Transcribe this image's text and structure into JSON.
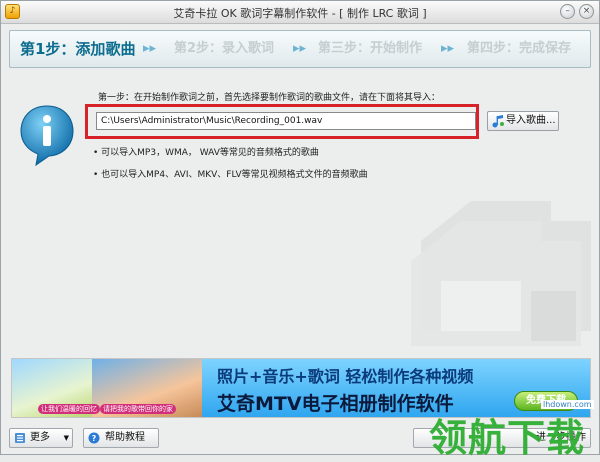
{
  "window": {
    "title": "艾奇卡拉 OK 歌词字幕制作软件 - [ 制作 LRC 歌词 ]",
    "app_icon_glyph": "♪"
  },
  "steps": [
    {
      "label": "第1步：添加歌曲",
      "active": true
    },
    {
      "label": "第2步：录入歌词",
      "active": false
    },
    {
      "label": "第三步：开始制作",
      "active": false
    },
    {
      "label": "第四步：完成保存",
      "active": false
    }
  ],
  "main": {
    "description": "第一步：在开始制作歌词之前，首先选择要制作歌词的歌曲文件，请在下面将其导入：",
    "file_path": "C:\\Users\\Administrator\\Music\\Recording_001.wav",
    "import_button": "导入歌曲...",
    "bullets": [
      "• 可以导入MP3，WMA， WAV等常见的音频格式的歌曲",
      "• 也可以导入MP4、AVI、MKV、FLV等常见视频格式文件的音频歌曲"
    ]
  },
  "ad": {
    "line1": "照片+音乐+歌词  轻松制作各种视频",
    "line2": "艾奇MTV电子相册制作软件",
    "download": "免费下载",
    "caption1": "让我们温暖的回忆",
    "caption2": "请把我的歌带回你的家"
  },
  "bottom": {
    "more": "更多",
    "help": "帮助教程",
    "next": "进一步操作"
  },
  "watermark": {
    "text": "领航下载",
    "url": "lhdown.com"
  },
  "colors": {
    "active_step": "#0d6d8f",
    "highlight_frame": "#d7222a",
    "watermark": "#2fae33"
  },
  "icons": [
    "info-icon",
    "music-note-icon",
    "arrow-right-icon",
    "help-icon",
    "list-icon",
    "close-icon",
    "minimize-icon"
  ]
}
